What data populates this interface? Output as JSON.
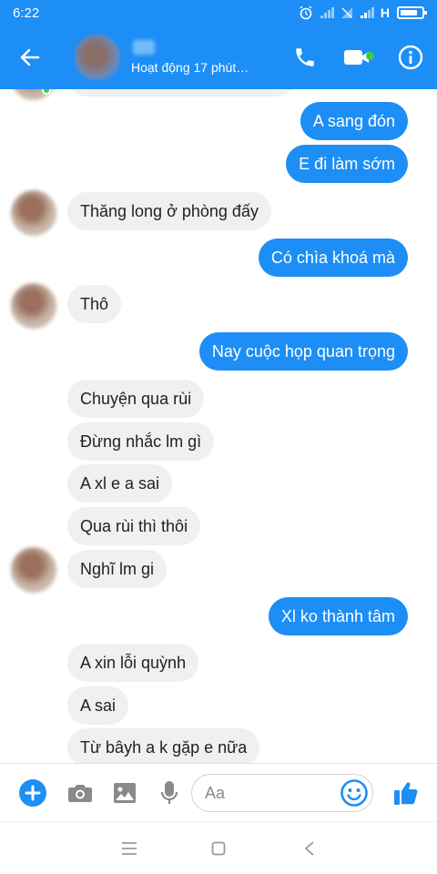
{
  "status_bar": {
    "time": "6:22",
    "network": "H"
  },
  "header": {
    "status": "Hoạt động 17 phút…"
  },
  "messages": [
    {
      "side": "out",
      "text": "A sang đón"
    },
    {
      "side": "out",
      "text": "E đi làm sớm"
    },
    {
      "side": "in",
      "text": "Thăng long ở phòng đấy"
    },
    {
      "side": "out",
      "text": "Có chìa khoá mà"
    },
    {
      "side": "in",
      "text": "Thô"
    },
    {
      "side": "out",
      "text": "Nay cuộc họp quan trọng"
    },
    {
      "side": "in",
      "text": "Chuyện qua rùi"
    },
    {
      "side": "in",
      "text": "Đừng nhắc lm gì"
    },
    {
      "side": "in",
      "text": "A xl e a sai"
    },
    {
      "side": "in",
      "text": "Qua rùi thì thôi"
    },
    {
      "side": "in",
      "text": "Nghĩ lm gi"
    },
    {
      "side": "out",
      "text": "Xl ko thành tâm"
    },
    {
      "side": "in",
      "text": "A xin lỗi quỳnh"
    },
    {
      "side": "in",
      "text": "A sai"
    },
    {
      "side": "in",
      "text": "Từ bâyh a k gặp e nữa"
    }
  ],
  "composer": {
    "placeholder": "Aa"
  },
  "icons": {
    "header": [
      "back-arrow-icon",
      "phone-icon",
      "video-icon",
      "info-icon"
    ],
    "composer": [
      "plus-icon",
      "camera-icon",
      "image-icon",
      "microphone-icon",
      "emoji-icon",
      "thumbs-up-icon"
    ],
    "navbar": [
      "menu-icon",
      "home-icon",
      "back-icon"
    ]
  },
  "colors": {
    "accent": "#1c8ef5",
    "incoming_bubble": "#f0f0f0",
    "online": "#3ccf3c"
  }
}
